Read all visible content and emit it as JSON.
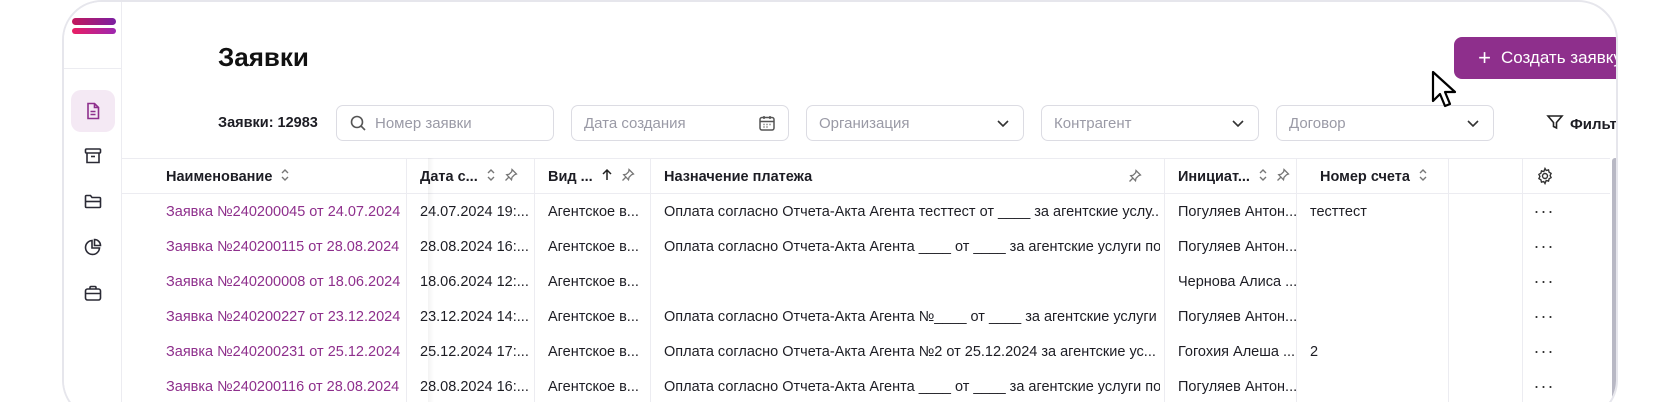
{
  "page": {
    "title": "Заявки",
    "create_label": "Создать заявку",
    "count_label": "Заявки: 12983"
  },
  "filters": {
    "search_placeholder": "Номер заявки",
    "date_placeholder": "Дата создания",
    "org_placeholder": "Организация",
    "contragent_placeholder": "Контрагент",
    "contract_placeholder": "Договор",
    "filters_label": "Фильтры"
  },
  "sidebar": {
    "items": [
      {
        "icon": "document-icon",
        "active": true
      },
      {
        "icon": "archive-icon",
        "active": false
      },
      {
        "icon": "folder-icon",
        "active": false
      },
      {
        "icon": "pie-chart-icon",
        "active": false
      },
      {
        "icon": "briefcase-icon",
        "active": false
      }
    ]
  },
  "colors": {
    "accent": "#8e2f8c",
    "link": "#8e2f8c",
    "active_bg": "#f4e9f4"
  },
  "table": {
    "columns": [
      {
        "label": "Наименование"
      },
      {
        "label": "Дата с..."
      },
      {
        "label": "Вид ..."
      },
      {
        "label": "Назначение платежа"
      },
      {
        "label": "Инициат..."
      },
      {
        "label": "Номер счета"
      }
    ],
    "rows": [
      {
        "name": "Заявка №240200045 от 24.07.2024",
        "date": "24.07.2024 19:...",
        "type": "Агентское в...",
        "purpose": "Оплата согласно Отчета-Акта Агента тесттест от ____ за агентские услу...",
        "initiator": "Погуляев Антон...",
        "account": "тесттест"
      },
      {
        "name": "Заявка №240200115 от 28.08.2024",
        "date": "28.08.2024 16:...",
        "type": "Агентское в...",
        "purpose": "Оплата согласно Отчета-Акта Агента ____ от ____ за агентские услуги по...",
        "initiator": "Погуляев Антон...",
        "account": ""
      },
      {
        "name": "Заявка №240200008 от 18.06.2024",
        "date": "18.06.2024 12:...",
        "type": "Агентское в...",
        "purpose": "",
        "initiator": "Чернова Алиса ...",
        "account": ""
      },
      {
        "name": "Заявка №240200227 от 23.12.2024",
        "date": "23.12.2024 14:...",
        "type": "Агентское в...",
        "purpose": "Оплата согласно Отчета-Акта Агента №____ от ____ за агентские услуги ...",
        "initiator": "Погуляев Антон...",
        "account": ""
      },
      {
        "name": "Заявка №240200231 от 25.12.2024",
        "date": "25.12.2024 17:...",
        "type": "Агентское в...",
        "purpose": "Оплата согласно Отчета-Акта Агента №2 от 25.12.2024 за агентские ус...",
        "initiator": "Гогохия Алеша ...",
        "account": "2"
      },
      {
        "name": "Заявка №240200116 от 28.08.2024",
        "date": "28.08.2024 16:...",
        "type": "Агентское в...",
        "purpose": "Оплата согласно Отчета-Акта Агента ____ от ____ за агентские услуги по...",
        "initiator": "Погуляев Антон...",
        "account": ""
      }
    ]
  }
}
